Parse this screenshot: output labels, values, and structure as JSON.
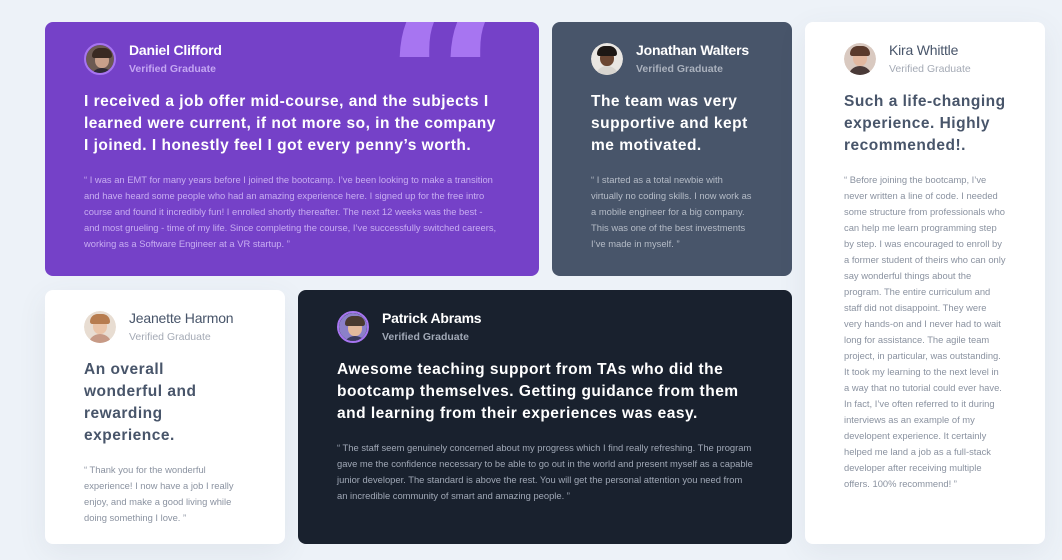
{
  "colors": {
    "page_bg": "#edf2f8",
    "purple": "#7541c8",
    "grayish_blue": "#48556a",
    "dark_blue": "#19212e",
    "white": "#ffffff",
    "quote_accent": "#a775f1"
  },
  "testimonials": [
    {
      "name": "Daniel Clifford",
      "role": "Verified Graduate",
      "headline": "I received a job offer mid-course, and the subjects I learned were current, if not more so, in the company I joined. I honestly feel I got every penny’s worth.",
      "body": "“ I was an EMT for many years before I joined the bootcamp. I’ve been looking to make a transition and have heard some people who had an amazing experience here. I signed up for the free intro course and found it incredibly fun! I enrolled shortly thereafter. The next 12 weeks was the best - and most grueling - time of my life. Since completing the course, I’ve successfully switched careers, working as a Software Engineer at a VR startup. ”",
      "quote_icon": "quotation-mark-icon"
    },
    {
      "name": "Jonathan Walters",
      "role": "Verified Graduate",
      "headline": "The team was very supportive and kept me motivated.",
      "body": "“ I started as a total newbie with virtually no coding skills. I now work as a mobile engineer for a big company. This was one of the best investments I’ve made in myself. ”"
    },
    {
      "name": "Kira Whittle",
      "role": "Verified Graduate",
      "headline": "Such a life-changing experience. Highly recommended!.",
      "body": "“ Before joining the bootcamp, I’ve never written a line of code. I needed some structure from professionals who can help me learn programming step by step. I was encouraged to enroll by a former student of theirs who can only say wonderful things about the program. The entire curriculum and staff did not disappoint. They were very hands-on and I never had to wait long for assistance. The agile team project, in particular, was outstanding. It took my learning to the next level in a way that no tutorial could ever have. In fact, I’ve often referred to it during interviews as an example of my developent experience. It certainly helped me land a job as a full-stack developer after receiving multiple offers. 100% recommend! ”"
    },
    {
      "name": "Jeanette Harmon",
      "role": "Verified Graduate",
      "headline": "An overall wonderful and rewarding experience.",
      "body": "“ Thank you for the wonderful experience! I now have a job I really enjoy, and make a good living while doing something I love. ”"
    },
    {
      "name": "Patrick Abrams",
      "role": "Verified Graduate",
      "headline": "Awesome teaching support from TAs who did the bootcamp themselves. Getting guidance from them and learning from their experiences was easy.",
      "body": "“ The staff seem genuinely concerned about my progress which I find really refreshing. The program gave me the confidence necessary to be able to go out in the world and present myself as a capable junior developer. The standard is above the rest. You will get the personal attention you need from an incredible community of smart and amazing people. ”"
    }
  ]
}
